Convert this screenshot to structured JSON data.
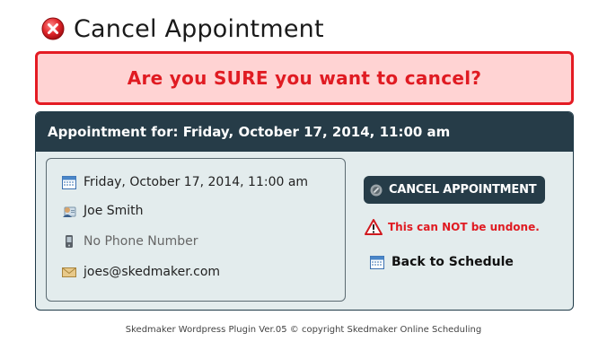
{
  "page": {
    "title": "Cancel Appointment",
    "icon": "cancel-x-icon"
  },
  "warning": {
    "text": "Are you SURE you want to cancel?"
  },
  "panel": {
    "header": "Appointment for: Friday, October 17, 2014, 11:00 am",
    "details": {
      "datetime": "Friday, October 17, 2014, 11:00 am",
      "name": "Joe Smith",
      "phone": "No Phone Number",
      "email": "joes@skedmaker.com"
    },
    "cancel_button_label": "CANCEL APPOINTMENT",
    "undo_warning": "This can NOT be undone.",
    "back_link": "Back to Schedule"
  },
  "footer": {
    "text": "Skedmaker Wordpress Plugin Ver.05 © copyright Skedmaker Online Scheduling"
  },
  "colors": {
    "accent_red": "#e01b22",
    "warning_bg": "#ffd3d3",
    "dark_header": "#263c48",
    "panel_bg": "#e3eced"
  }
}
